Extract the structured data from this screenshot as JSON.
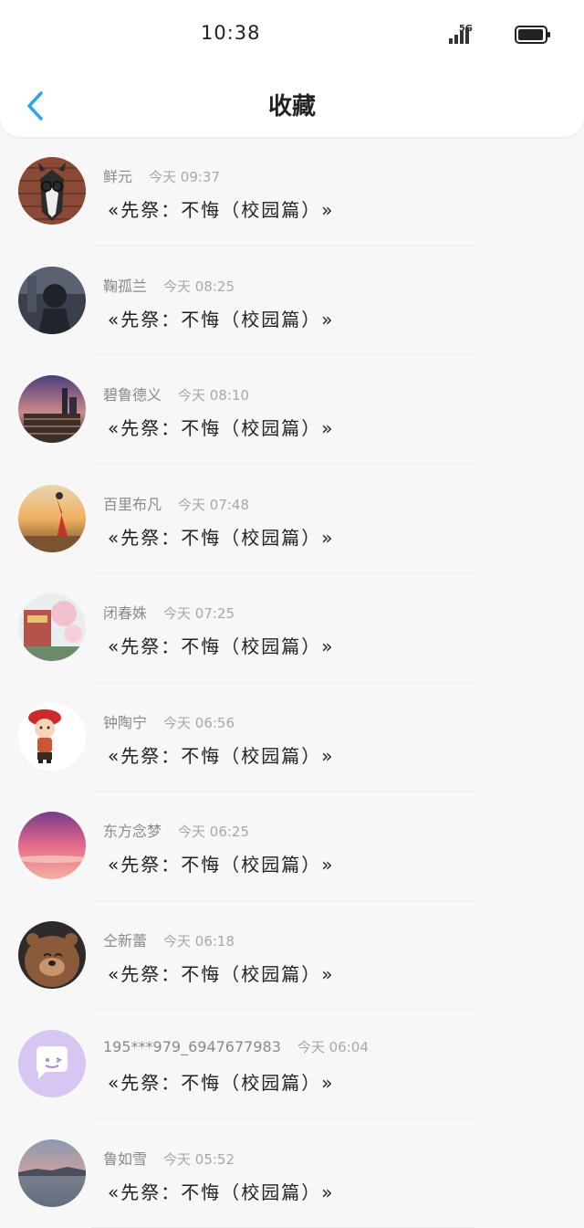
{
  "status_bar": {
    "time": "10:38",
    "network": "5G"
  },
  "header": {
    "title": "收藏"
  },
  "items": [
    {
      "name": "鲜元",
      "time": "今天 09:37",
      "title": "«先祭：不悔（校园篇）»",
      "avatar": "husky-dog"
    },
    {
      "name": "鞠孤兰",
      "time": "今天 08:25",
      "title": "«先祭：不悔（校园篇）»",
      "avatar": "anime-boy"
    },
    {
      "name": "碧鲁德义",
      "time": "今天 08:10",
      "title": "«先祭：不悔（校园篇）»",
      "avatar": "city-skyline"
    },
    {
      "name": "百里布凡",
      "time": "今天 07:48",
      "title": "«先祭：不悔（校园篇）»",
      "avatar": "girl-sunset"
    },
    {
      "name": "闭春姝",
      "time": "今天 07:25",
      "title": "«先祭：不悔（校园篇）»",
      "avatar": "temple-blossom"
    },
    {
      "name": "钟陶宁",
      "time": "今天 06:56",
      "title": "«先祭：不悔（校园篇）»",
      "avatar": "cartoon-boy"
    },
    {
      "name": "东方念梦",
      "time": "今天 06:25",
      "title": "«先祭：不悔（校园篇）»",
      "avatar": "pink-sunset"
    },
    {
      "name": "仝新蕾",
      "time": "今天 06:18",
      "title": "«先祭：不悔（校园篇）»",
      "avatar": "bear"
    },
    {
      "name": "195***979_6947677983",
      "time": "今天 06:04",
      "title": "«先祭：不悔（校园篇）»",
      "avatar": "chat-bubble"
    },
    {
      "name": "鲁如雪",
      "time": "今天 05:52",
      "title": "«先祭：不悔（校园篇）»",
      "avatar": "lake-dusk"
    }
  ]
}
